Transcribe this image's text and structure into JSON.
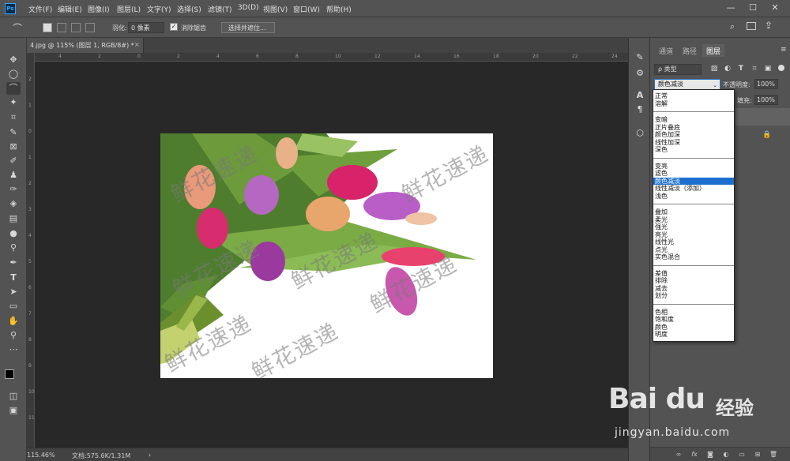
{
  "app": {
    "logo": "Ps"
  },
  "menu": [
    "文件(F)",
    "编辑(E)",
    "图像(I)",
    "图层(L)",
    "文字(Y)",
    "选择(S)",
    "滤镜(T)",
    "3D(D)",
    "视图(V)",
    "窗口(W)",
    "帮助(H)"
  ],
  "window_controls": {
    "minimize": "—",
    "maximize": "☐",
    "close": "✕"
  },
  "options": {
    "feather_label": "羽化:",
    "feather_value": "0 像素",
    "antialias_label": "消除锯齿",
    "antialias_checked": true,
    "select_mask_button": "选择并遮住..."
  },
  "document": {
    "tab_title": "4.jpg @ 115% (图层 1, RGB/8#) *",
    "close": "×",
    "watermark_text": "鲜花速递",
    "hruler_ticks": [
      "4",
      "2",
      "0",
      "2",
      "4",
      "6",
      "8",
      "10",
      "12",
      "14",
      "16",
      "18",
      "20",
      "22",
      "24"
    ],
    "vruler_ticks": [
      "2",
      "1",
      "0",
      "1",
      "2",
      "3",
      "4",
      "5",
      "6",
      "7",
      "8",
      "9",
      "10",
      "11"
    ]
  },
  "status": {
    "zoom": "115.46%",
    "doc": "文档:575.6K/1.31M",
    "arrow": "›"
  },
  "panel_tabs": [
    "通道",
    "路径",
    "图层"
  ],
  "layers": {
    "filter_label": "ρ 类型",
    "blend_mode": "颜色减淡",
    "opacity_label": "不透明度:",
    "opacity_value": "100%",
    "fill_label": "填充:",
    "fill_value": "100%"
  },
  "blend_groups": [
    [
      "正常",
      "溶解"
    ],
    [
      "变暗",
      "正片叠底",
      "颜色加深",
      "线性加深",
      "深色"
    ],
    [
      "变亮",
      "滤色",
      "颜色减淡",
      "线性减淡（添加）",
      "浅色"
    ],
    [
      "叠加",
      "柔光",
      "强光",
      "亮光",
      "线性光",
      "点光",
      "实色混合"
    ],
    [
      "差值",
      "排除",
      "减去",
      "划分"
    ],
    [
      "色相",
      "饱和度",
      "颜色",
      "明度"
    ]
  ],
  "selected_blend": "颜色减淡",
  "baidu": {
    "logo": "Bai du",
    "jingyan": "经验",
    "url": "jingyan.baidu.com"
  },
  "colors": {
    "selection": "#1c6fcf",
    "ps_blue": "#31a8ff"
  },
  "icons": {
    "tools": [
      "move-icon",
      "marquee-icon",
      "polygon-lasso-icon",
      "magic-wand-icon",
      "crop-icon",
      "eyedropper-icon",
      "frame-icon",
      "brush-icon",
      "stamp-icon",
      "history-brush-icon",
      "eraser-icon",
      "gradient-icon",
      "blur-icon",
      "dodge-icon",
      "pen-icon",
      "type-icon",
      "path-select-icon",
      "rectangle-icon",
      "hand-icon",
      "zoom-icon",
      "more-icon"
    ]
  }
}
